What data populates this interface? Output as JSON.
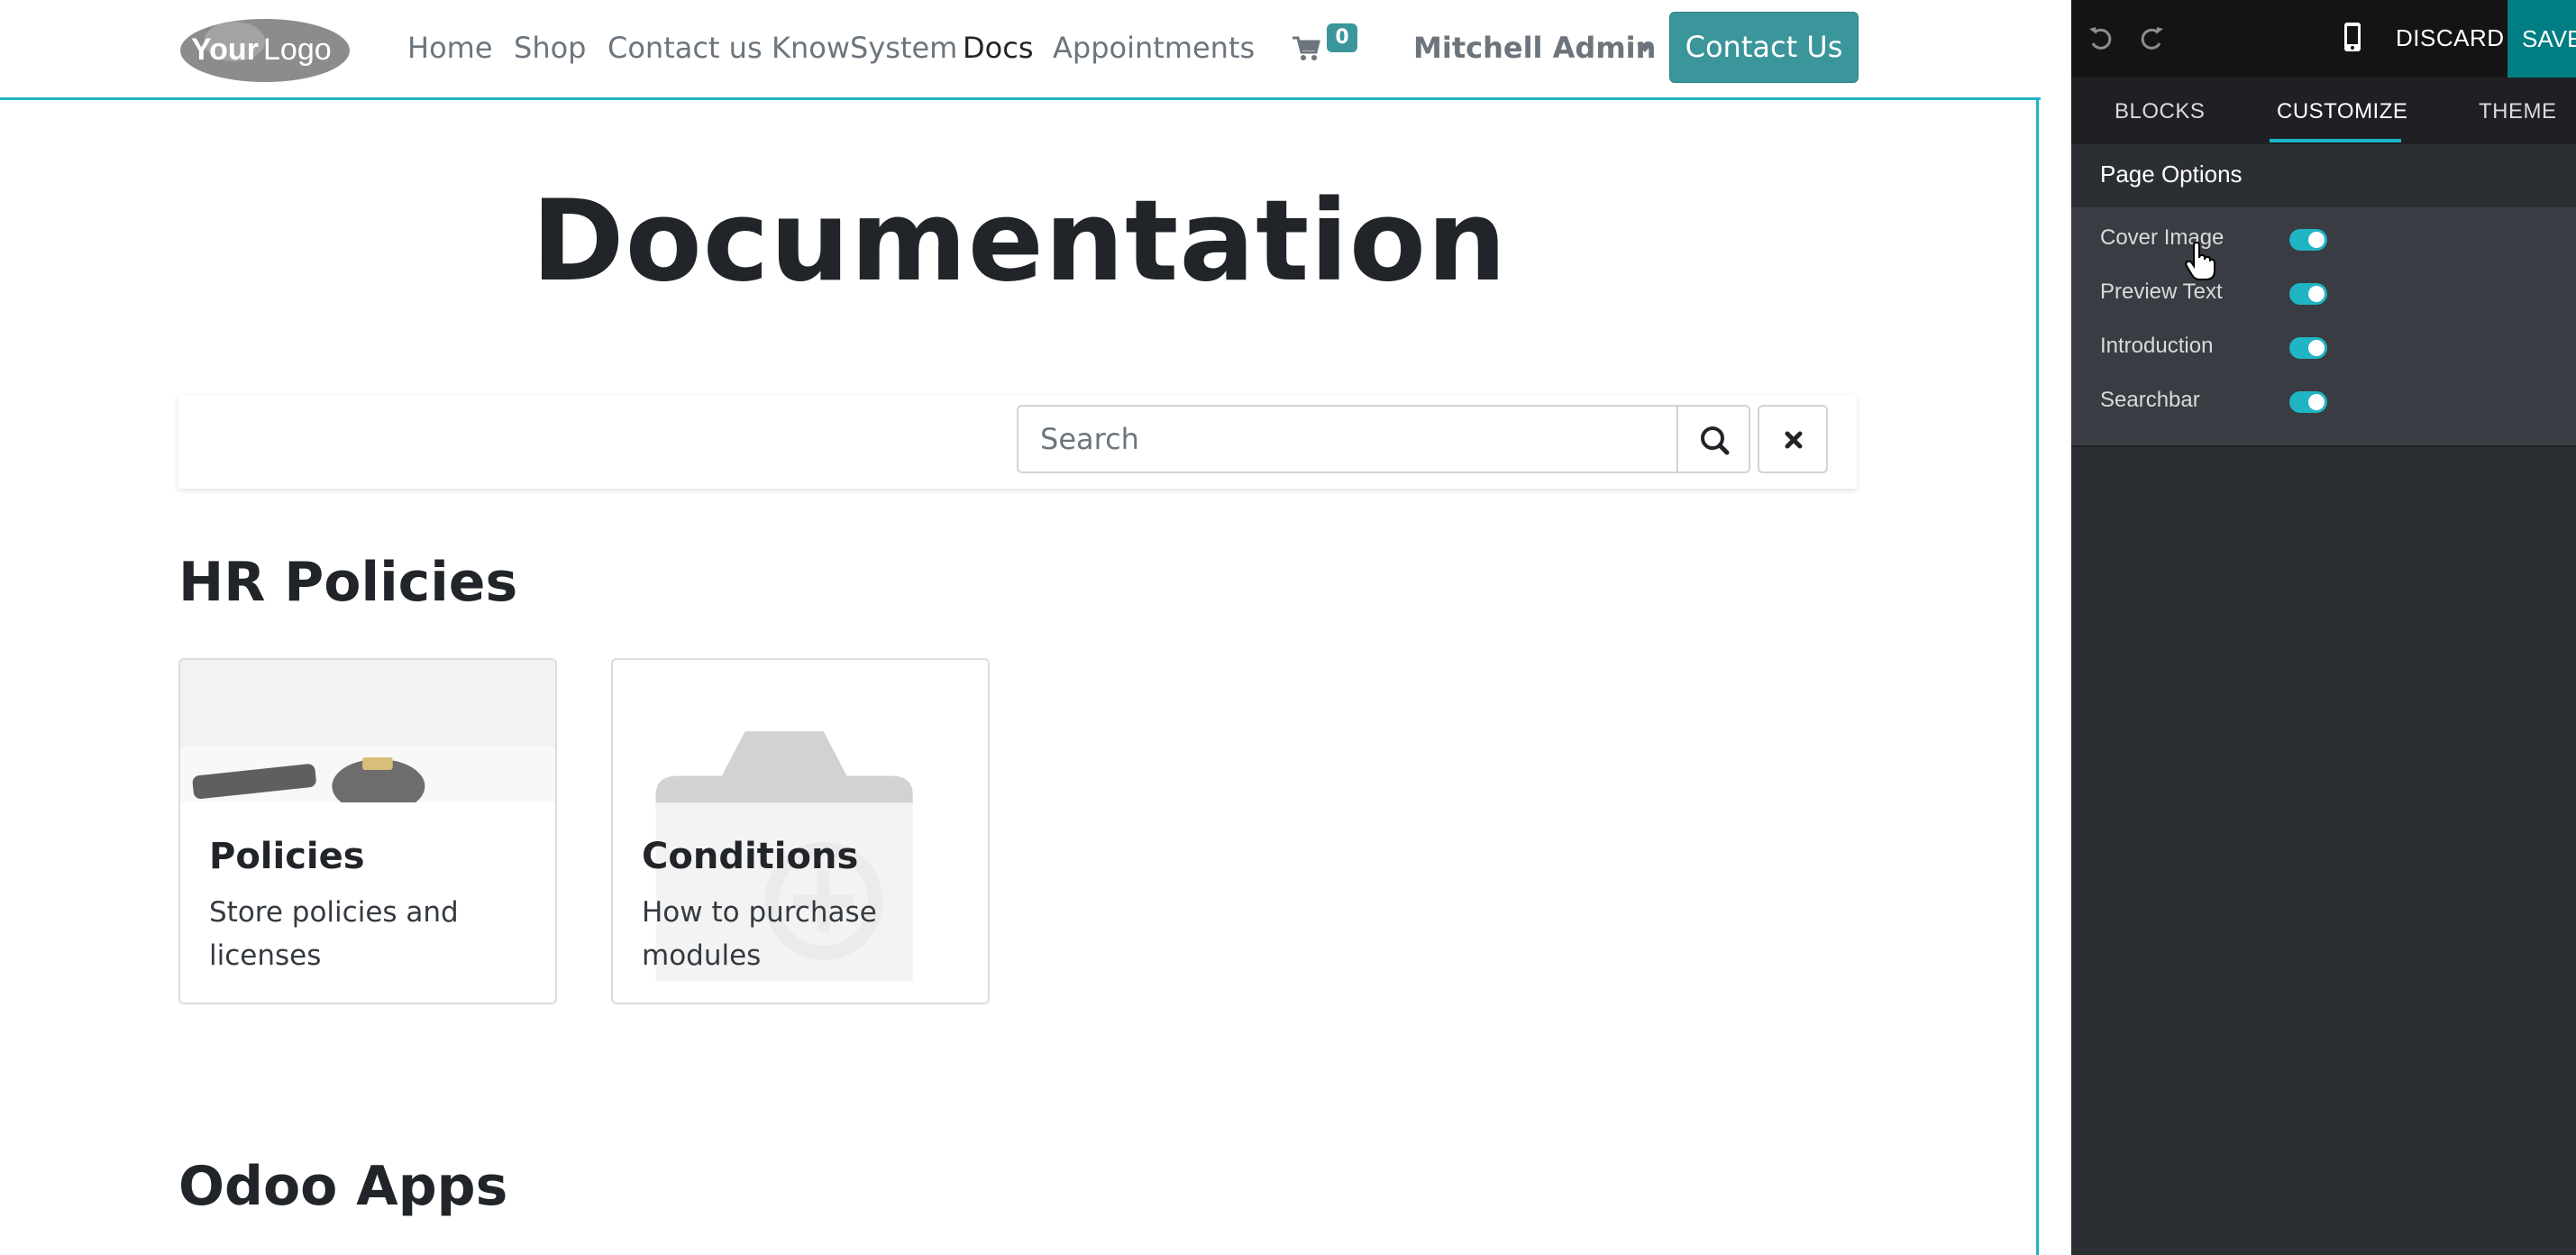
{
  "navbar": {
    "logo_text": "YourLogo",
    "links": [
      "Home",
      "Shop",
      "Contact us",
      "KnowSystem",
      "Docs",
      "Appointments"
    ],
    "active_link": "Docs",
    "cart_count": "0",
    "user_name": "Mitchell Admin",
    "contact_button": "Contact Us"
  },
  "page": {
    "title": "Documentation",
    "search_placeholder": "Search"
  },
  "sections": [
    {
      "title": "HR Policies",
      "cards": [
        {
          "title": "Policies",
          "description": "Store policies and licenses"
        },
        {
          "title": "Conditions",
          "description": "How to purchase modules"
        }
      ]
    },
    {
      "title": "Odoo Apps"
    }
  ],
  "editor": {
    "discard_label": "DISCARD",
    "save_label": "SAVE",
    "tabs": [
      "BLOCKS",
      "CUSTOMIZE",
      "THEME"
    ],
    "active_tab": "CUSTOMIZE",
    "section_title": "Page Options",
    "options": [
      {
        "label": "Cover Image",
        "enabled": true
      },
      {
        "label": "Preview Text",
        "enabled": true
      },
      {
        "label": "Introduction",
        "enabled": true
      },
      {
        "label": "Searchbar",
        "enabled": true
      }
    ]
  },
  "colors": {
    "accent": "#1fb5c4",
    "brand_button": "#3a969a",
    "save": "#017e84"
  }
}
